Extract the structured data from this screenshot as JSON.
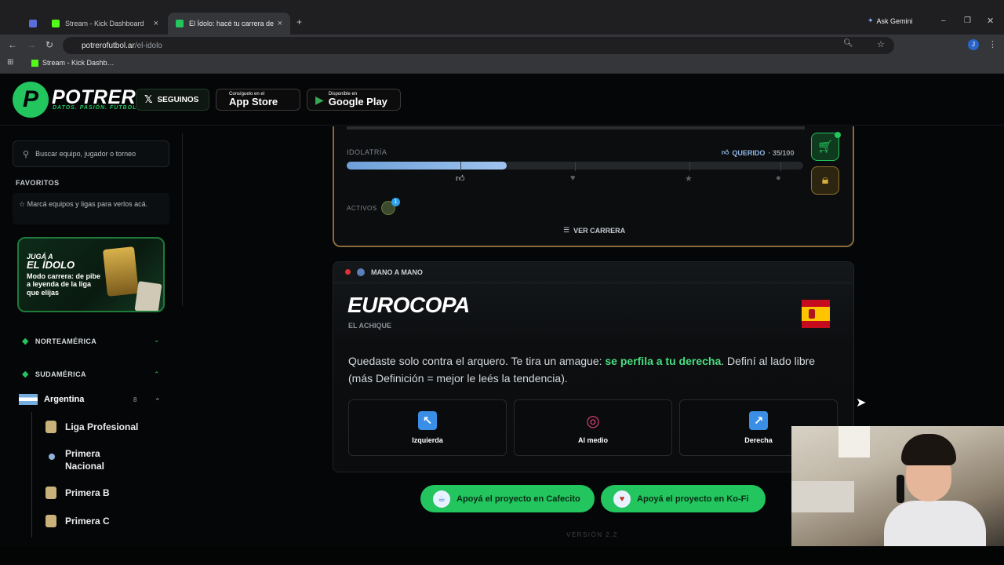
{
  "browser": {
    "tabs": [
      {
        "label": "",
        "icon": "profile-icon",
        "color": "#5b6dd8"
      },
      {
        "label": "Stream - Kick Dashboard",
        "icon": "kick-icon",
        "color": "#53fc18"
      },
      {
        "label": "El Ídolo: hacé tu carrera de fut…",
        "icon": "potrero-icon",
        "color": "#22c55e"
      }
    ],
    "ask_gemini": "Ask Gemini",
    "url_domain": "potrerofutbol.ar",
    "url_path": "/el-idolo",
    "bookmark": "Stream - Kick Dashb…"
  },
  "header": {
    "logo_letter": "P",
    "logo_text": "POTRERO",
    "logo_tagline": "DATOS. PASIÓN. FUTBOL.",
    "x_button": "SEGUINOS",
    "appstore_small": "Consíguelo en el",
    "appstore_big": "App Store",
    "gplay_small": "Disponible en",
    "gplay_big": "Google Play"
  },
  "sidebar": {
    "search_placeholder": "Buscar equipo, jugador o torneo",
    "favorites_title": "FAVORITOS",
    "favorites_hint": "Marcá equipos y ligas para verlos acá.",
    "promo_line1": "JUGÁ A",
    "promo_line2": "EL ÍDOLO",
    "promo_text": "Modo carrera: de pibe a leyenda de la liga que elijas",
    "regions": [
      "NORTEAMÉRICA",
      "SUDAMÉRICA"
    ],
    "country": "Argentina",
    "country_count": "8",
    "leagues": [
      "Liga Profesional",
      "Primera Nacional",
      "Primera B",
      "Primera C"
    ]
  },
  "career": {
    "idolatria_label": "IDOLATRÍA",
    "status": "QUERIDO",
    "score": "· 35/100",
    "progress": 0.35,
    "activos_label": "ACTIVOS",
    "activos_badge": "1",
    "ver_carrera": "VER CARRERA"
  },
  "match": {
    "type_label": "MANO A MANO",
    "competition": "EUROCOPA",
    "subtitle": "EL ACHIQUE",
    "desc_pre": "Quedaste solo contra el arquero. Te tira un amague: ",
    "desc_highlight": "se perfila a tu derecha",
    "desc_post": ". Definí al lado libre (más Definición = mejor le leés la tendencia).",
    "options": [
      "Izquierda",
      "Al medio",
      "Derecha"
    ]
  },
  "footer": {
    "cafecito": "Apoyá el proyecto en Cafecito",
    "kofi": "Apoyá el proyecto en Ko-Fi",
    "version": "VERSIÓN 2.2"
  }
}
